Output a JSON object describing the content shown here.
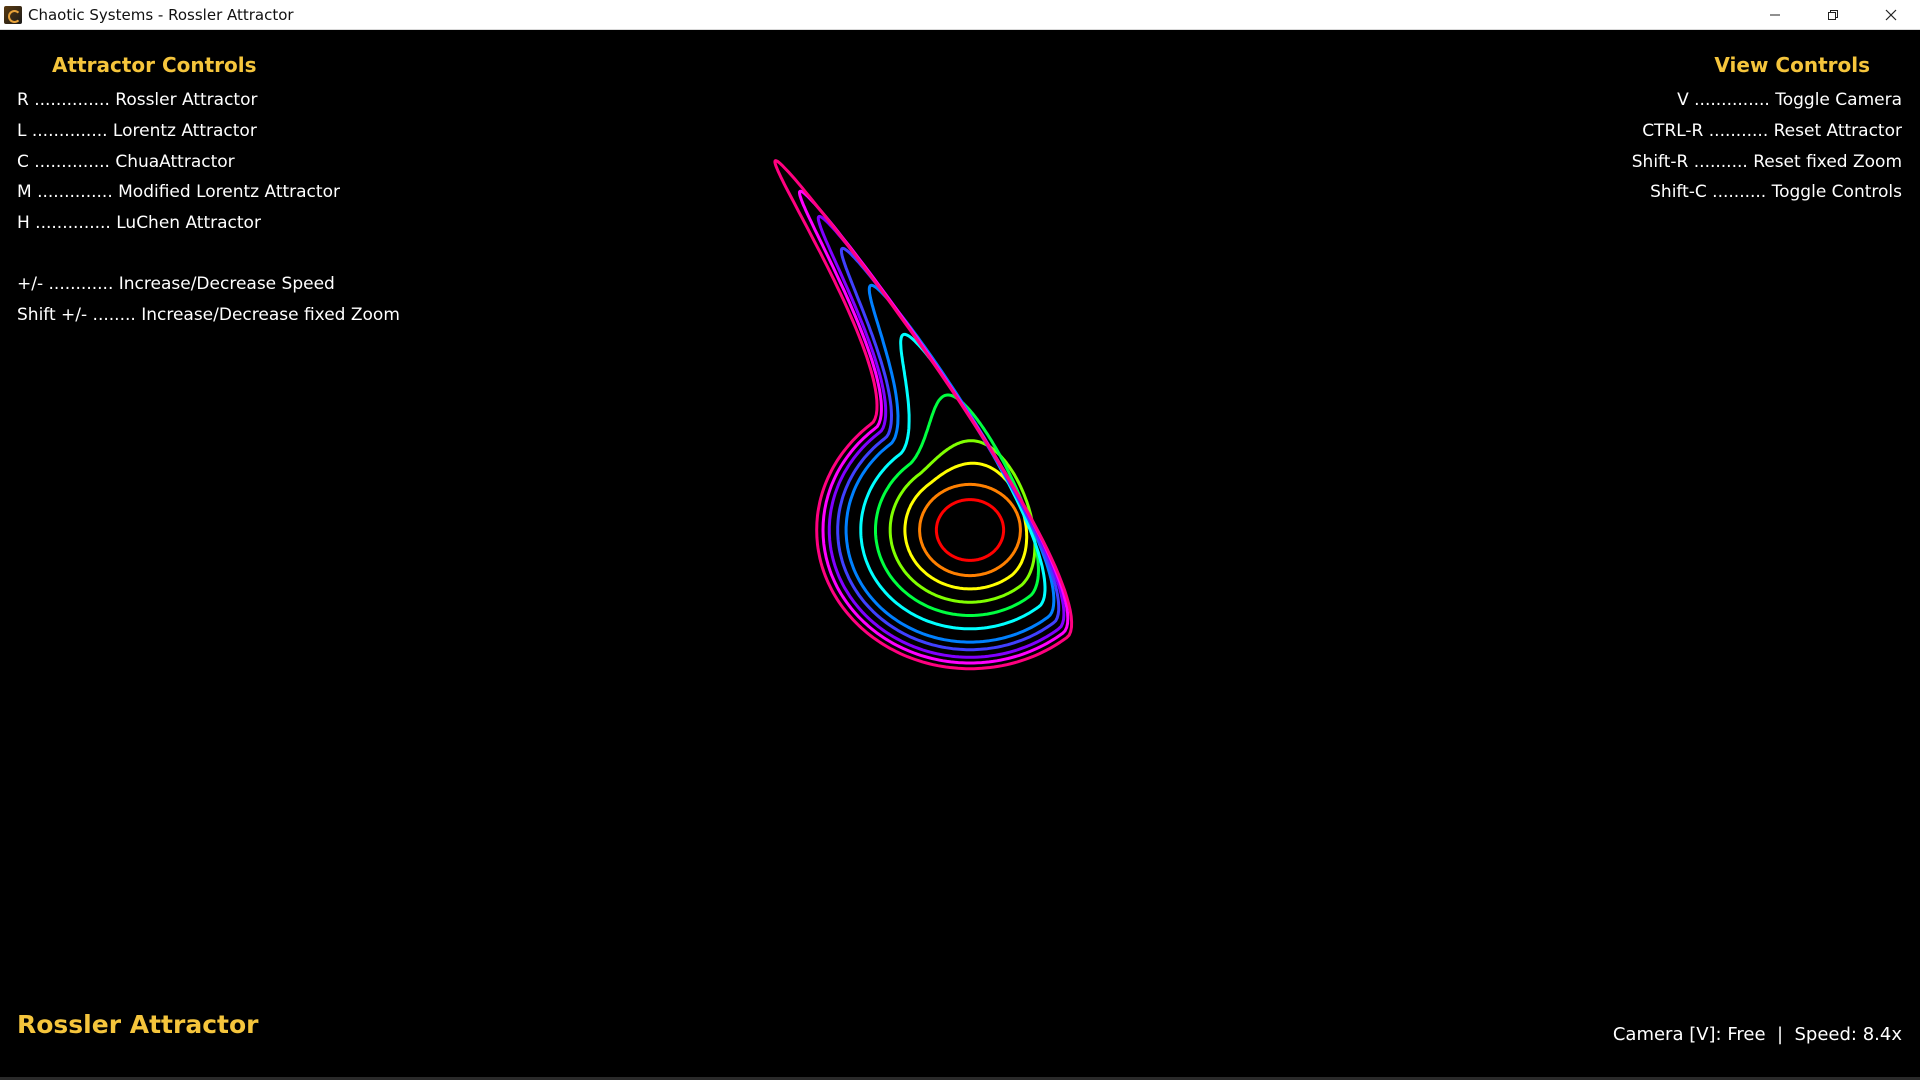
{
  "window": {
    "title": "Chaotic Systems - Rossler Attractor",
    "buttons": [
      "minimize-icon",
      "restore-icon",
      "close-icon"
    ]
  },
  "attractor_controls": {
    "title": "Attractor Controls",
    "items": [
      "R .............. Rossler Attractor",
      "L .............. Lorentz Attractor",
      "C .............. ChuaAttractor",
      "M .............. Modified Lorentz Attractor",
      "H .............. LuChen Attractor",
      "+/- ............ Increase/Decrease Speed",
      "Shift +/- ........ Increase/Decrease fixed Zoom"
    ]
  },
  "view_controls": {
    "title": "View Controls",
    "items": [
      "V .............. Toggle Camera",
      "CTRL-R ........... Reset Attractor",
      "Shift-R .......... Reset fixed Zoom",
      "Shift-C .......... Toggle Controls"
    ]
  },
  "mode_label": "Rossler Attractor",
  "status": "Camera [V]: Free  |  Speed: 8.4x",
  "colors": {
    "accent": "#f5c53c",
    "background": "#000000",
    "text": "#ffffff",
    "trail": [
      "#ff0000",
      "#ff8000",
      "#ffff00",
      "#80ff00",
      "#00ff40",
      "#00ffff",
      "#0080ff",
      "#4040ff",
      "#8000ff",
      "#ff00ff",
      "#ff0080"
    ]
  }
}
